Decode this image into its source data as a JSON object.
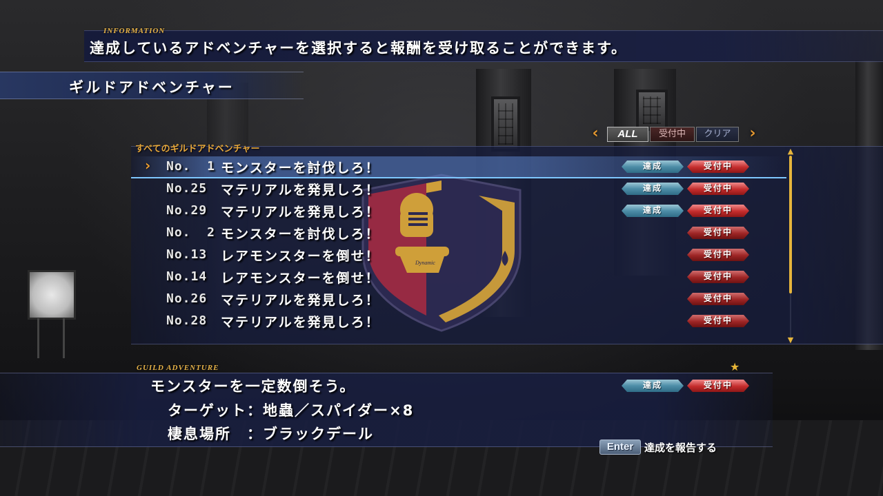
{
  "information": {
    "label": "INFORMATION",
    "text": "達成しているアドベンチャーを選択すると報酬を受け取ることができます。"
  },
  "header": {
    "title": "ギルドアドベンチャー"
  },
  "filter": {
    "prev_symbol": "‹",
    "next_symbol": "›",
    "tabs": [
      {
        "label": "ALL",
        "selected": true
      },
      {
        "label": "受付中",
        "selected": false
      },
      {
        "label": "クリア",
        "selected": false
      }
    ]
  },
  "list": {
    "label": "すべてのギルドアドベンチャー",
    "cursor_symbol": "›",
    "rows": [
      {
        "number": "No.  1",
        "title": "モンスターを討伐しろ！",
        "done": true,
        "done_label": "達成",
        "status": "受付中",
        "selected": true
      },
      {
        "number": "No.25",
        "title": "マテリアルを発見しろ！",
        "done": true,
        "done_label": "達成",
        "status": "受付中",
        "selected": false
      },
      {
        "number": "No.29",
        "title": "マテリアルを発見しろ！",
        "done": true,
        "done_label": "達成",
        "status": "受付中",
        "selected": false
      },
      {
        "number": "No.  2",
        "title": "モンスターを討伐しろ！",
        "done": false,
        "done_label": "",
        "status": "受付中",
        "selected": false
      },
      {
        "number": "No.13",
        "title": "レアモンスターを倒せ！",
        "done": false,
        "done_label": "",
        "status": "受付中",
        "selected": false
      },
      {
        "number": "No.14",
        "title": "レアモンスターを倒せ！",
        "done": false,
        "done_label": "",
        "status": "受付中",
        "selected": false
      },
      {
        "number": "No.26",
        "title": "マテリアルを発見しろ！",
        "done": false,
        "done_label": "",
        "status": "受付中",
        "selected": false
      },
      {
        "number": "No.28",
        "title": "マテリアルを発見しろ！",
        "done": false,
        "done_label": "",
        "status": "受付中",
        "selected": false
      }
    ]
  },
  "scrollbar": {
    "up_symbol": "▲",
    "down_symbol": "▼",
    "position": 0.0
  },
  "detail": {
    "label": "GUILD ADVENTURE",
    "star_symbol": "★",
    "title": "モンスターを一定数倒そう。",
    "target_line": "ターゲット：地蟲／スパイダー×8",
    "habitat_line": "棲息場所　：ブラックデール",
    "done_label": "達成",
    "status_label": "受付中"
  },
  "footer": {
    "key_label": "Enter",
    "action_label": "達成を報告する"
  },
  "emblem": {
    "icon": "knight-helmet-shield-emblem",
    "inscription": "Dynamic"
  },
  "colors": {
    "accent_gold": "#e7b349",
    "badge_done": "#4e8ea8",
    "badge_accept": "#c42c2c",
    "panel_blue": "#18203f"
  }
}
